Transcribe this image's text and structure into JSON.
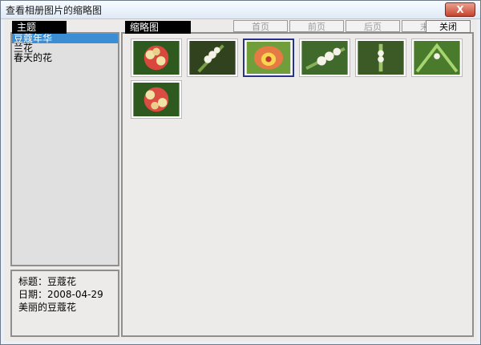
{
  "window": {
    "title": "查看相册图片的缩略图",
    "close_symbol": "X"
  },
  "themes": {
    "header": "主题",
    "items": [
      "豆蔻年华",
      "兰花",
      "春天的花"
    ],
    "selected_index": 0
  },
  "info": {
    "title_line": "标题：豆蔻花",
    "date_line": "日期：2008-04-29",
    "desc_line": "美丽的豆蔻花"
  },
  "thumbnails": {
    "header": "缩略图",
    "nav": {
      "first": "首页",
      "prev": "前页",
      "next": "后页",
      "last": "末页"
    },
    "close_label": "关闭",
    "items": [
      {
        "name": "red-flower"
      },
      {
        "name": "white-buds"
      },
      {
        "name": "orange-flower",
        "selected": true
      },
      {
        "name": "white-buds-2"
      },
      {
        "name": "green-spike"
      },
      {
        "name": "green-leaves"
      },
      {
        "name": "red-flower-2"
      }
    ]
  }
}
